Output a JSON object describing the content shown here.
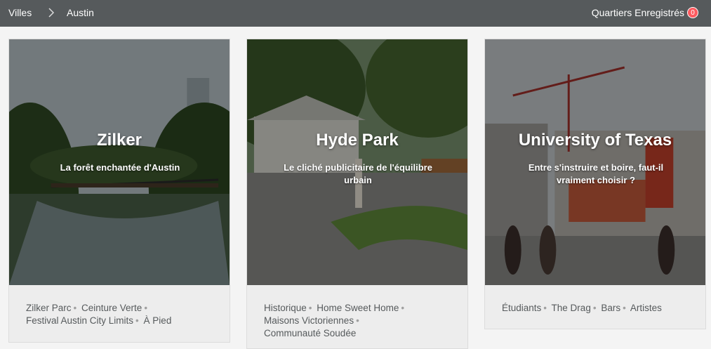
{
  "breadcrumb": {
    "root": "Villes",
    "current": "Austin"
  },
  "saved": {
    "label": "Quartiers Enregistrés",
    "count": "0"
  },
  "cards": [
    {
      "title": "Zilker",
      "subtitle": "La forêt enchantée d'Austin",
      "tags": [
        "Zilker Parc",
        "Ceinture Verte",
        "Festival Austin City Limits",
        "À Pied"
      ]
    },
    {
      "title": "Hyde Park",
      "subtitle": "Le cliché publicitaire de l'équilibre urbain",
      "tags": [
        "Historique",
        "Home Sweet Home",
        "Maisons Victoriennes",
        "Communauté Soudée"
      ]
    },
    {
      "title": "University of Texas",
      "subtitle": "Entre s'instruire et boire, faut-il vraiment choisir ?",
      "tags": [
        "Étudiants",
        "The Drag",
        "Bars",
        "Artistes"
      ]
    }
  ],
  "colors": {
    "topbar": "#565a5c",
    "badge": "#ff5a5f",
    "background": "#f4f4f4"
  }
}
